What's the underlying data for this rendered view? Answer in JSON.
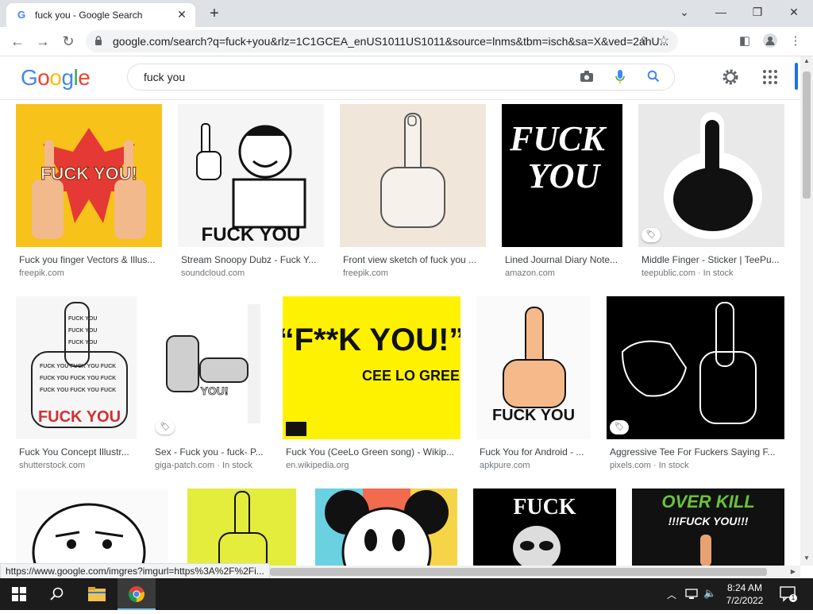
{
  "browser": {
    "tab_title": "fuck you - Google Search",
    "tab_close": "✕",
    "new_tab": "+",
    "url": "google.com/search?q=fuck+you&rlz=1C1GCEA_enUS1011US1011&source=lnms&tbm=isch&sa=X&ved=2ahU...",
    "status_url": "https://www.google.com/imgres?imgurl=https%3A%2F%2Fi..."
  },
  "google": {
    "logo_letters": [
      "G",
      "o",
      "o",
      "g",
      "l",
      "e"
    ],
    "logo_colors": [
      "#4285f4",
      "#ea4335",
      "#fbbc05",
      "#4285f4",
      "#34a853",
      "#ea4335"
    ],
    "query": "fuck you"
  },
  "results_row1": [
    {
      "caption": "Fuck you finger Vectors & Illus...",
      "source": "freepik.com",
      "stock": ""
    },
    {
      "caption": "Stream Snoopy Dubz - Fuck Y...",
      "source": "soundcloud.com",
      "stock": ""
    },
    {
      "caption": "Front view sketch of fuck you ...",
      "source": "freepik.com",
      "stock": ""
    },
    {
      "caption": "Lined Journal Diary Note...",
      "source": "amazon.com",
      "stock": ""
    },
    {
      "caption": "Middle Finger - Sticker | TeePu...",
      "source": "teepublic.com",
      "stock": "In stock"
    }
  ],
  "results_row2": [
    {
      "caption": "Fuck You Concept Illustr...",
      "source": "shutterstock.com",
      "stock": ""
    },
    {
      "caption": "Sex - Fuck you - fuck- P...",
      "source": "giga-patch.com",
      "stock": "In stock"
    },
    {
      "caption": "Fuck You (CeeLo Green song) - Wikip...",
      "source": "en.wikipedia.org",
      "stock": ""
    },
    {
      "caption": "Fuck You for Android - ...",
      "source": "apkpure.com",
      "stock": ""
    },
    {
      "caption": "Aggressive Tee For Fuckers Saying F...",
      "source": "pixels.com",
      "stock": "In stock"
    }
  ],
  "thumb_text": {
    "t1": "FUCK YOU!",
    "t2": "FUCK YOU",
    "t4a": "FUCK",
    "t4b": "YOU",
    "t5": "FUCK YOU",
    "t6": "FUCK YOU",
    "t7": "YOU!",
    "t8a": "“F**K YOU!”",
    "t8b": "CEE LO GREEN",
    "t9": "FUCK YOU",
    "t13": "FUCK",
    "t14a": "OVER KILL",
    "t14b": "!!!FUCK YOU!!!"
  },
  "taskbar": {
    "time": "8:24 AM",
    "date": "7/2/2022",
    "notif_count": "1"
  }
}
